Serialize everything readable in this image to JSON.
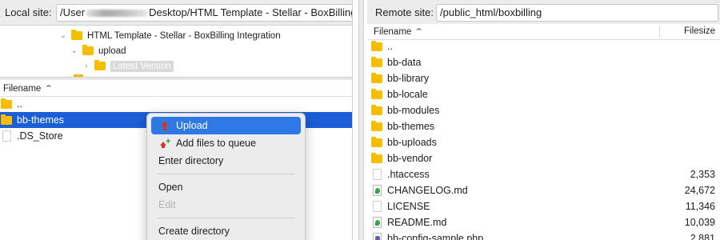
{
  "local": {
    "site_label": "Local site:",
    "path_prefix": "/User",
    "path_suffix": "Desktop/HTML Template - Stellar - BoxBilling",
    "tree": [
      {
        "label": "HTML Template - Stellar - BoxBilling Integration",
        "chevron": "⌄"
      },
      {
        "label": "upload",
        "chevron": "⌄"
      },
      {
        "label": "Latest Version",
        "chevron": "›"
      }
    ],
    "column_filename": "Filename",
    "files": [
      {
        "name": "..",
        "icon": "folder-icon"
      },
      {
        "name": "bb-themes",
        "icon": "folder-icon",
        "selected": true
      },
      {
        "name": ".DS_Store",
        "icon": "file-icon"
      }
    ]
  },
  "context_menu": {
    "items": [
      {
        "label": "Upload",
        "icon": "upload-icon",
        "active": true
      },
      {
        "label": "Add files to queue",
        "icon": "add-to-queue-icon"
      },
      {
        "label": "Enter directory"
      },
      {
        "separator": true
      },
      {
        "label": "Open"
      },
      {
        "label": "Edit",
        "disabled": true
      },
      {
        "separator": true
      },
      {
        "label": "Create directory"
      }
    ]
  },
  "remote": {
    "site_label": "Remote site:",
    "path": "/public_html/boxbilling",
    "column_filename": "Filename",
    "column_filesize": "Filesize",
    "files": [
      {
        "name": "..",
        "icon": "folder-icon",
        "size": ""
      },
      {
        "name": "bb-data",
        "icon": "folder-icon",
        "size": ""
      },
      {
        "name": "bb-library",
        "icon": "folder-icon",
        "size": ""
      },
      {
        "name": "bb-locale",
        "icon": "folder-icon",
        "size": ""
      },
      {
        "name": "bb-modules",
        "icon": "folder-icon",
        "size": ""
      },
      {
        "name": "bb-themes",
        "icon": "folder-icon",
        "size": ""
      },
      {
        "name": "bb-uploads",
        "icon": "folder-icon",
        "size": ""
      },
      {
        "name": "bb-vendor",
        "icon": "folder-icon",
        "size": ""
      },
      {
        "name": ".htaccess",
        "icon": "file-icon",
        "size": "2,353"
      },
      {
        "name": "CHANGELOG.md",
        "icon": "markdown-file-icon",
        "size": "24,672"
      },
      {
        "name": "LICENSE",
        "icon": "file-icon",
        "size": "11,346"
      },
      {
        "name": "README.md",
        "icon": "markdown-file-icon",
        "size": "10,039"
      },
      {
        "name": "bb-config-sample.php",
        "icon": "php-file-icon",
        "size": "2,881"
      }
    ]
  },
  "colors": {
    "selection": "#1c5ed6",
    "menu_highlight": "#2f79e6",
    "folder": "#f7bd00"
  }
}
